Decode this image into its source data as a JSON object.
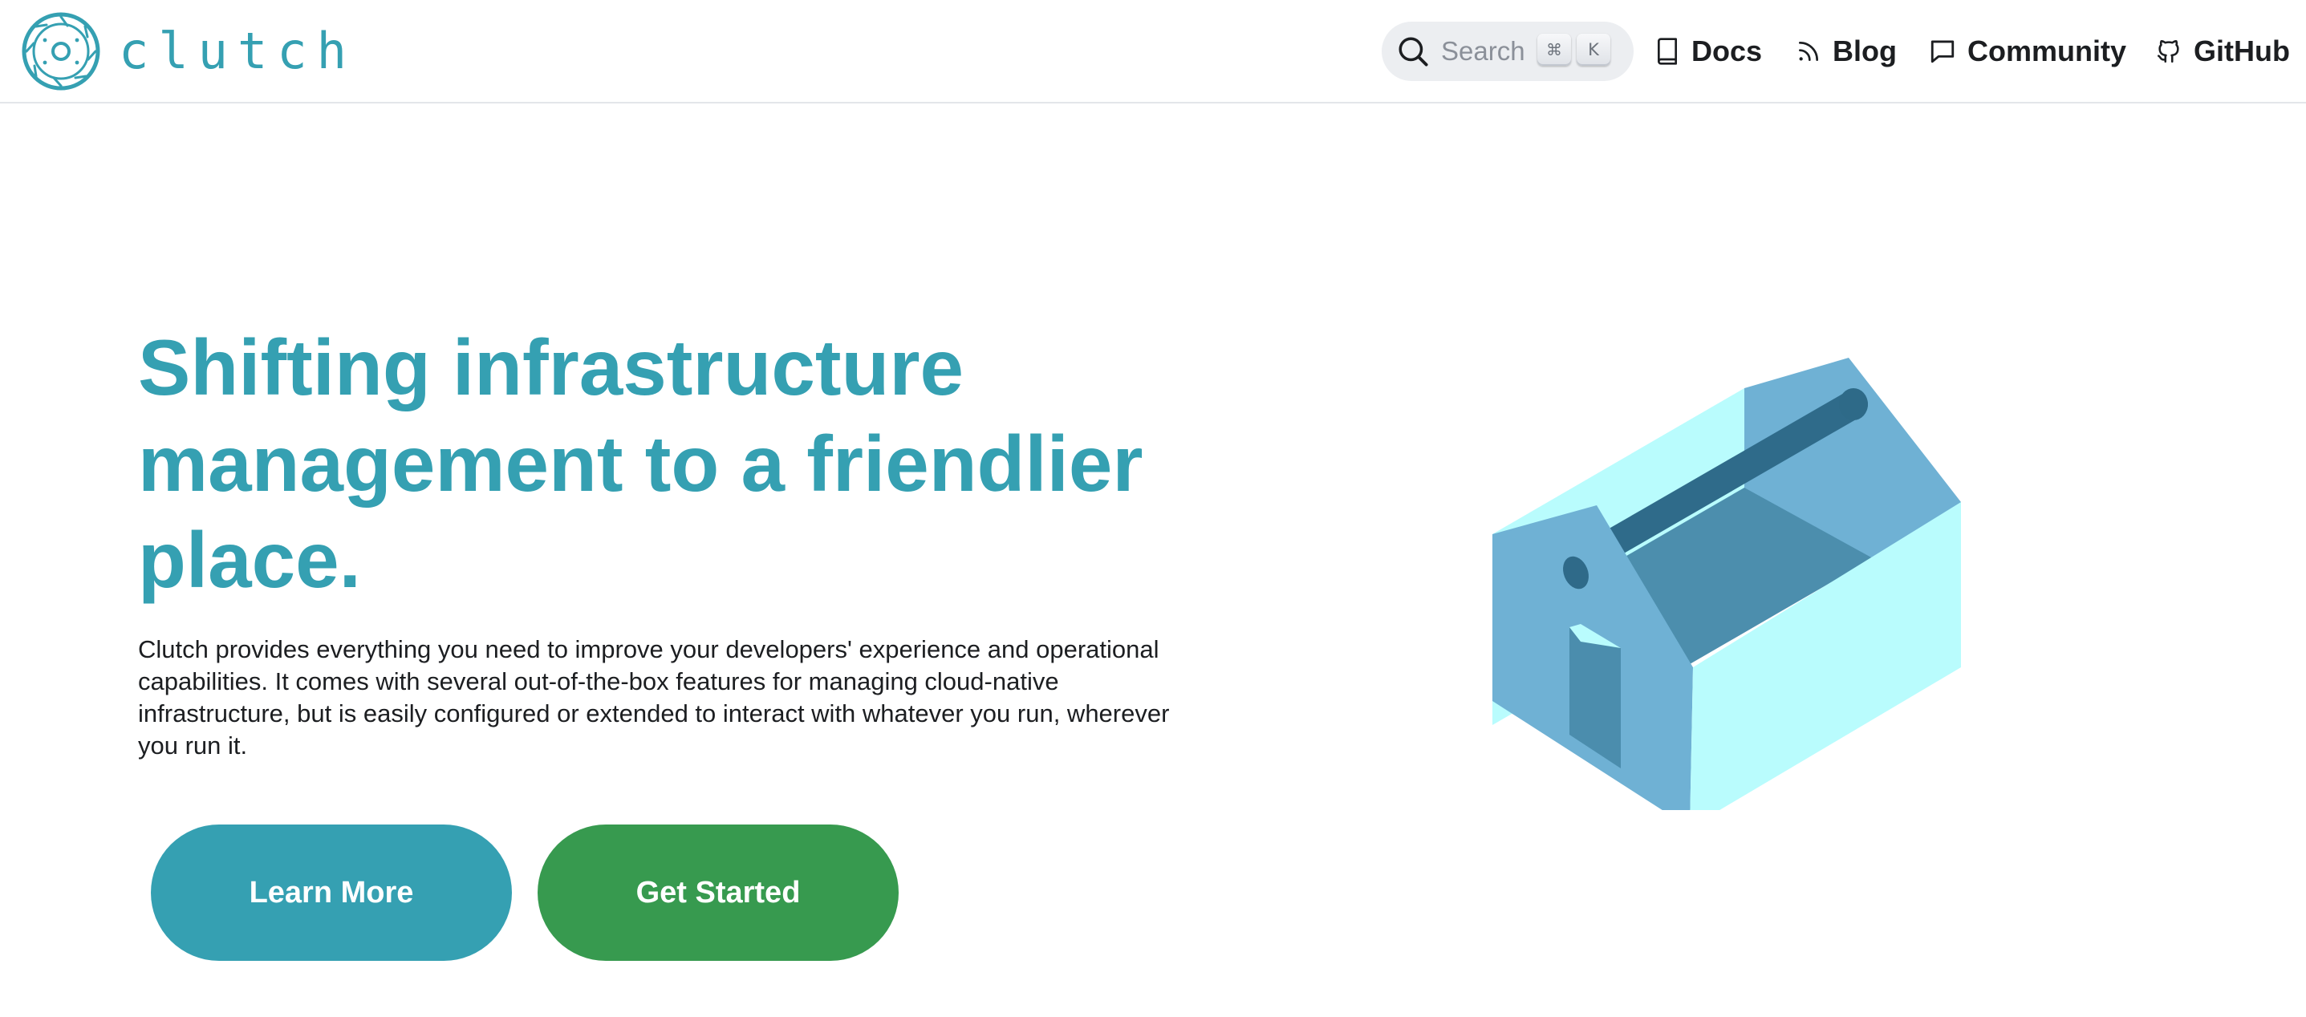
{
  "brand": {
    "name": "clutch",
    "color": "#35a0b2"
  },
  "search": {
    "placeholder": "Search",
    "shortcut_modifier": "⌘",
    "shortcut_key": "K"
  },
  "nav": {
    "items": [
      {
        "label": "Docs",
        "icon": "book-icon"
      },
      {
        "label": "Blog",
        "icon": "rss-icon"
      },
      {
        "label": "Community",
        "icon": "chat-bubble-icon"
      },
      {
        "label": "GitHub",
        "icon": "github-icon"
      }
    ]
  },
  "hero": {
    "title": "Shifting infrastructure management to a friendlier place.",
    "description": "Clutch provides everything you need to improve your developers' experience and operational capabilities. It comes with several out-of-the-box features for managing cloud-native infrastructure, but is easily configured or extended to interact with whatever you run, wherever you run it.",
    "buttons": {
      "learn_more": "Learn More",
      "get_started": "Get Started"
    },
    "illustration": "toolbox-illustration"
  },
  "colors": {
    "accent": "#35a0b2",
    "primary_button": "#35a0b2",
    "secondary_button": "#379a4f",
    "text": "#1c1e21"
  }
}
